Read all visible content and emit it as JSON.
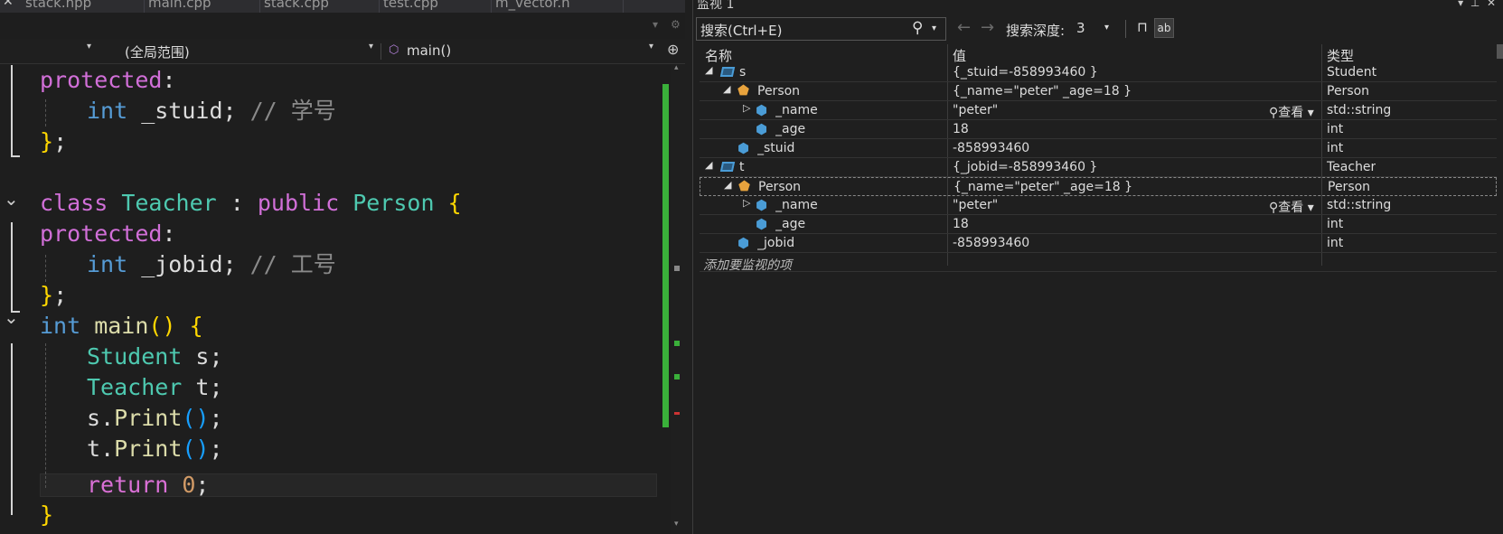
{
  "tabs": [
    "stack.hpp",
    "main.cpp",
    "stack.cpp",
    "test.cpp",
    "m_vector.h"
  ],
  "nav": {
    "scope": "(全局范围)",
    "function": "main()"
  },
  "code": {
    "l1": {
      "kw": "protected",
      ":": ":"
    },
    "l2": {
      "type": "int",
      "name": " _stuid",
      "semi": ";",
      "comment": " // 学号"
    },
    "l3": {
      "brace": "}",
      "semi": ";"
    },
    "l4": {
      "class": "class",
      "name": " Teacher",
      "colon": " : ",
      "public": "public",
      "base": " Person",
      "brace": " {"
    },
    "l5": {
      "kw": "protected",
      ":": ":"
    },
    "l6": {
      "type": "int",
      "name": " _jobid",
      "semi": ";",
      "comment": " // 工号"
    },
    "l7": {
      "brace": "}",
      "semi": ";"
    },
    "l8": {
      "int": "int",
      "fn": " main",
      "paren": "()",
      "brace": " {"
    },
    "l9": {
      "type": "Student",
      "var": " s",
      "semi": ";"
    },
    "l10": {
      "type": "Teacher",
      "var": " t",
      "semi": ";"
    },
    "l11": {
      "obj": "s",
      "dot": ".",
      "fn": "Print",
      "paren": "()",
      "semi": ";"
    },
    "l12": {
      "obj": "t",
      "dot": ".",
      "fn": "Print",
      "paren": "()",
      "semi": ";"
    },
    "l13": {
      "kw": "return",
      "num": " 0",
      "semi": ";"
    },
    "l14": {
      "brace": "}"
    }
  },
  "watch": {
    "title": "监视 1",
    "search_placeholder": "搜索(Ctrl+E)",
    "depth_label": "搜索深度:",
    "depth_value": "3",
    "headers": {
      "name": "名称",
      "value": "值",
      "type": "类型"
    },
    "rows": [
      {
        "name": "s",
        "value": "{_stuid=-858993460 }",
        "type": "Student"
      },
      {
        "name": "Person",
        "value": "{_name=\"peter\" _age=18 }",
        "type": "Person"
      },
      {
        "name": "_name",
        "value": "\"peter\"",
        "type": "std::string",
        "view": "查看"
      },
      {
        "name": "_age",
        "value": "18",
        "type": "int"
      },
      {
        "name": "_stuid",
        "value": "-858993460",
        "type": "int"
      },
      {
        "name": "t",
        "value": "{_jobid=-858993460 }",
        "type": "Teacher"
      },
      {
        "name": "Person",
        "value": "{_name=\"peter\" _age=18 }",
        "type": "Person"
      },
      {
        "name": "_name",
        "value": "\"peter\"",
        "type": "std::string",
        "view": "查看"
      },
      {
        "name": "_age",
        "value": "18",
        "type": "int"
      },
      {
        "name": "_jobid",
        "value": "-858993460",
        "type": "int"
      }
    ],
    "add_item": "添加要监视的项"
  },
  "colors": {
    "keyword": "#d16fd8",
    "type": "#4ec9b0",
    "comment": "#6a9955",
    "function": "#dcdcaa",
    "number": "#d19a66",
    "change_bar": "#3ab03a"
  }
}
